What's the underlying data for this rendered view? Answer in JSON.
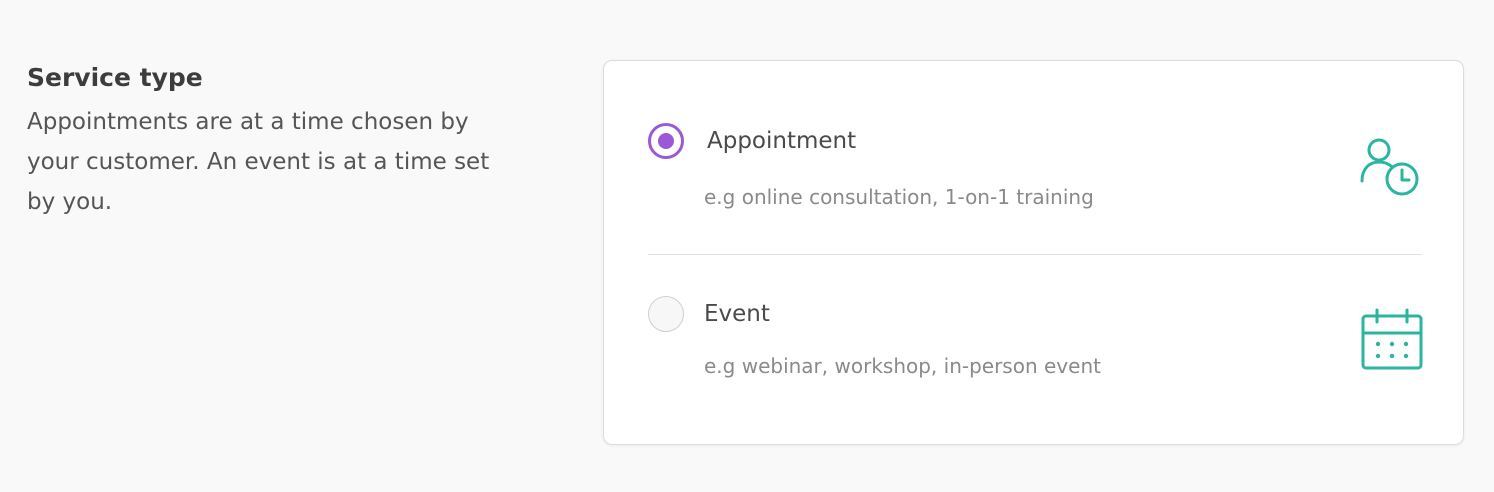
{
  "section": {
    "title": "Service type",
    "description": "Appointments are at a time chosen by your customer. An event is at a time set by you."
  },
  "options": [
    {
      "label": "Appointment",
      "description": "e.g online consultation, 1-on-1 training",
      "selected": true,
      "icon": "user-clock-icon"
    },
    {
      "label": "Event",
      "description": "e.g webinar, workshop, in-person event",
      "selected": false,
      "icon": "calendar-icon"
    }
  ],
  "colors": {
    "accent": "#9b59d6",
    "icon": "#2bb5a0",
    "background": "#f9f9f9"
  }
}
